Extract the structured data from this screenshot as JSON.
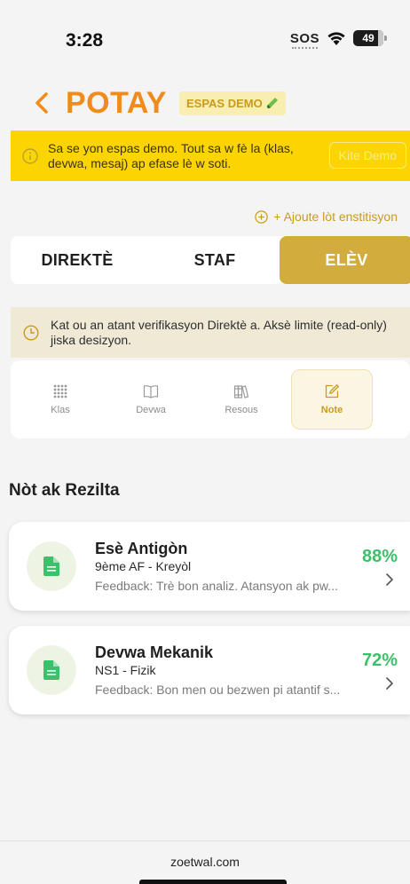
{
  "status_bar": {
    "time": "3:28",
    "sos": "SOS",
    "battery": "49"
  },
  "header": {
    "title": "POTAY",
    "badge": "ESPAS DEMO"
  },
  "demo_banner": {
    "text": "Sa se yon espas demo. Tout sa w fè la (klas, devwa, mesaj) ap efase lè w soti.",
    "exit_label": "Kite Demo"
  },
  "add_institution": "+ Ajoute lòt enstitisyon",
  "role_tabs": [
    {
      "label": "DIREKTÈ",
      "active": false
    },
    {
      "label": "STAF",
      "active": false
    },
    {
      "label": "ELÈV",
      "active": true
    }
  ],
  "verification_notice": "Kat ou an atant verifikasyon Direktè a. Aksè limite (read-only) jiska desizyon.",
  "student_nav": [
    {
      "label": "Klas",
      "icon": "grid-dots-icon"
    },
    {
      "label": "Devwa",
      "icon": "book-open-icon"
    },
    {
      "label": "Resous",
      "icon": "library-icon"
    },
    {
      "label": "Note",
      "icon": "edit-note-icon",
      "active": true
    }
  ],
  "section_title": "Nòt ak Rezilta",
  "grades": [
    {
      "title": "Esè Antigòn",
      "subtitle": "9ème AF - Kreyòl",
      "feedback": "Feedback: Trè bon analiz. Atansyon ak pw...",
      "score": "88%"
    },
    {
      "title": "Devwa Mekanik",
      "subtitle": "NS1 - Fizik",
      "feedback": "Feedback: Bon men ou bezwen pi atantif s...",
      "score": "72%"
    }
  ],
  "footer": {
    "domain": "zoetwal.com"
  },
  "colors": {
    "accent_orange": "#f08c1e",
    "gold": "#d2ac3c",
    "banner_yellow": "#fcd500",
    "score_green": "#3cc06a"
  }
}
